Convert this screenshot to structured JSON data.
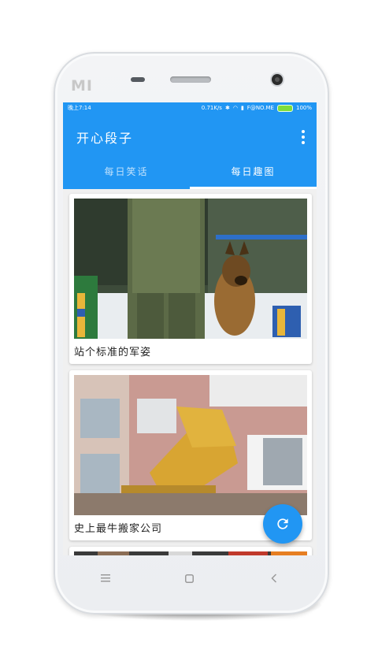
{
  "device": {
    "brand_logo": "MI"
  },
  "status_bar": {
    "time": "晚上7:14",
    "speed": "0.71K/s",
    "carrier": "F@NO.ME",
    "battery": "100%"
  },
  "app_bar": {
    "title": "开心段子",
    "menu_icon": "more-vert-icon"
  },
  "tabs": [
    {
      "label": "每日笑话",
      "active": false
    },
    {
      "label": "每日趣图",
      "active": true
    }
  ],
  "cards": [
    {
      "caption": "站个标准的军姿",
      "image": "soldier-and-dog-photo"
    },
    {
      "caption": "史上最牛搬家公司",
      "image": "excavator-moving-photo"
    },
    {
      "caption": "",
      "image": "partial-photo"
    }
  ],
  "fab": {
    "icon": "refresh-icon"
  },
  "nav_bar": {
    "icons": [
      "menu-icon",
      "home-icon",
      "back-icon"
    ]
  },
  "colors": {
    "primary": "#2196f3",
    "background": "#f0f0f0"
  }
}
